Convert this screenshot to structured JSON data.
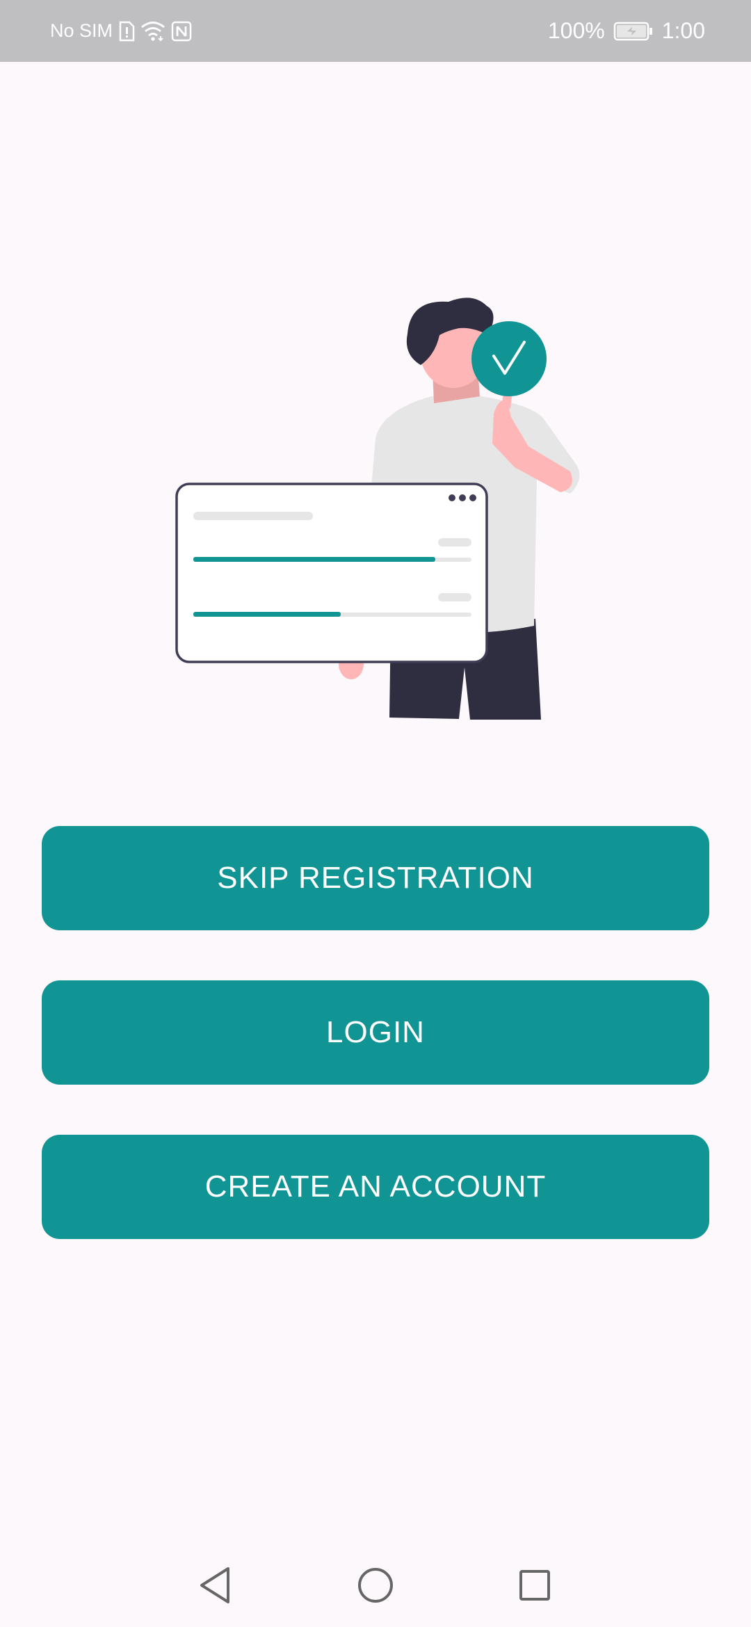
{
  "status_bar": {
    "carrier": "No SIM",
    "battery": "100%",
    "time": "1:00",
    "icons": [
      "sim-alert-icon",
      "wifi-icon",
      "nfc-icon",
      "battery-charging-icon"
    ]
  },
  "illustration": {
    "name": "person-thumbs-up-checkmark",
    "accent": "#119594",
    "dark": "#2f2e41",
    "skin": "#ffb6b6",
    "shirt": "#e6e6e6"
  },
  "buttons": {
    "skip_registration": "SKIP REGISTRATION",
    "login": "LOGIN",
    "create_account": "CREATE AN ACCOUNT"
  },
  "nav_bar": {
    "icons": [
      "back-icon",
      "home-icon",
      "recents-icon"
    ]
  },
  "colors": {
    "primary": "#119594",
    "background": "#fdf8fb",
    "status_bar": "#bfbec1"
  }
}
